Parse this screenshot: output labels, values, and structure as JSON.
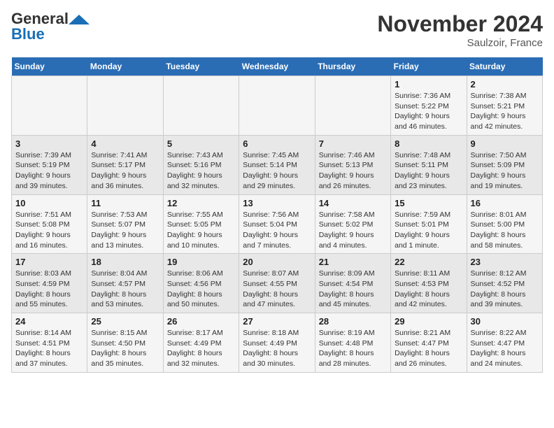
{
  "logo": {
    "general": "General",
    "blue": "Blue"
  },
  "header": {
    "month": "November 2024",
    "location": "Saulzoir, France"
  },
  "days_of_week": [
    "Sunday",
    "Monday",
    "Tuesday",
    "Wednesday",
    "Thursday",
    "Friday",
    "Saturday"
  ],
  "weeks": [
    [
      {
        "day": "",
        "info": ""
      },
      {
        "day": "",
        "info": ""
      },
      {
        "day": "",
        "info": ""
      },
      {
        "day": "",
        "info": ""
      },
      {
        "day": "",
        "info": ""
      },
      {
        "day": "1",
        "info": "Sunrise: 7:36 AM\nSunset: 5:22 PM\nDaylight: 9 hours and 46 minutes."
      },
      {
        "day": "2",
        "info": "Sunrise: 7:38 AM\nSunset: 5:21 PM\nDaylight: 9 hours and 42 minutes."
      }
    ],
    [
      {
        "day": "3",
        "info": "Sunrise: 7:39 AM\nSunset: 5:19 PM\nDaylight: 9 hours and 39 minutes."
      },
      {
        "day": "4",
        "info": "Sunrise: 7:41 AM\nSunset: 5:17 PM\nDaylight: 9 hours and 36 minutes."
      },
      {
        "day": "5",
        "info": "Sunrise: 7:43 AM\nSunset: 5:16 PM\nDaylight: 9 hours and 32 minutes."
      },
      {
        "day": "6",
        "info": "Sunrise: 7:45 AM\nSunset: 5:14 PM\nDaylight: 9 hours and 29 minutes."
      },
      {
        "day": "7",
        "info": "Sunrise: 7:46 AM\nSunset: 5:13 PM\nDaylight: 9 hours and 26 minutes."
      },
      {
        "day": "8",
        "info": "Sunrise: 7:48 AM\nSunset: 5:11 PM\nDaylight: 9 hours and 23 minutes."
      },
      {
        "day": "9",
        "info": "Sunrise: 7:50 AM\nSunset: 5:09 PM\nDaylight: 9 hours and 19 minutes."
      }
    ],
    [
      {
        "day": "10",
        "info": "Sunrise: 7:51 AM\nSunset: 5:08 PM\nDaylight: 9 hours and 16 minutes."
      },
      {
        "day": "11",
        "info": "Sunrise: 7:53 AM\nSunset: 5:07 PM\nDaylight: 9 hours and 13 minutes."
      },
      {
        "day": "12",
        "info": "Sunrise: 7:55 AM\nSunset: 5:05 PM\nDaylight: 9 hours and 10 minutes."
      },
      {
        "day": "13",
        "info": "Sunrise: 7:56 AM\nSunset: 5:04 PM\nDaylight: 9 hours and 7 minutes."
      },
      {
        "day": "14",
        "info": "Sunrise: 7:58 AM\nSunset: 5:02 PM\nDaylight: 9 hours and 4 minutes."
      },
      {
        "day": "15",
        "info": "Sunrise: 7:59 AM\nSunset: 5:01 PM\nDaylight: 9 hours and 1 minute."
      },
      {
        "day": "16",
        "info": "Sunrise: 8:01 AM\nSunset: 5:00 PM\nDaylight: 8 hours and 58 minutes."
      }
    ],
    [
      {
        "day": "17",
        "info": "Sunrise: 8:03 AM\nSunset: 4:59 PM\nDaylight: 8 hours and 55 minutes."
      },
      {
        "day": "18",
        "info": "Sunrise: 8:04 AM\nSunset: 4:57 PM\nDaylight: 8 hours and 53 minutes."
      },
      {
        "day": "19",
        "info": "Sunrise: 8:06 AM\nSunset: 4:56 PM\nDaylight: 8 hours and 50 minutes."
      },
      {
        "day": "20",
        "info": "Sunrise: 8:07 AM\nSunset: 4:55 PM\nDaylight: 8 hours and 47 minutes."
      },
      {
        "day": "21",
        "info": "Sunrise: 8:09 AM\nSunset: 4:54 PM\nDaylight: 8 hours and 45 minutes."
      },
      {
        "day": "22",
        "info": "Sunrise: 8:11 AM\nSunset: 4:53 PM\nDaylight: 8 hours and 42 minutes."
      },
      {
        "day": "23",
        "info": "Sunrise: 8:12 AM\nSunset: 4:52 PM\nDaylight: 8 hours and 39 minutes."
      }
    ],
    [
      {
        "day": "24",
        "info": "Sunrise: 8:14 AM\nSunset: 4:51 PM\nDaylight: 8 hours and 37 minutes."
      },
      {
        "day": "25",
        "info": "Sunrise: 8:15 AM\nSunset: 4:50 PM\nDaylight: 8 hours and 35 minutes."
      },
      {
        "day": "26",
        "info": "Sunrise: 8:17 AM\nSunset: 4:49 PM\nDaylight: 8 hours and 32 minutes."
      },
      {
        "day": "27",
        "info": "Sunrise: 8:18 AM\nSunset: 4:49 PM\nDaylight: 8 hours and 30 minutes."
      },
      {
        "day": "28",
        "info": "Sunrise: 8:19 AM\nSunset: 4:48 PM\nDaylight: 8 hours and 28 minutes."
      },
      {
        "day": "29",
        "info": "Sunrise: 8:21 AM\nSunset: 4:47 PM\nDaylight: 8 hours and 26 minutes."
      },
      {
        "day": "30",
        "info": "Sunrise: 8:22 AM\nSunset: 4:47 PM\nDaylight: 8 hours and 24 minutes."
      }
    ]
  ]
}
